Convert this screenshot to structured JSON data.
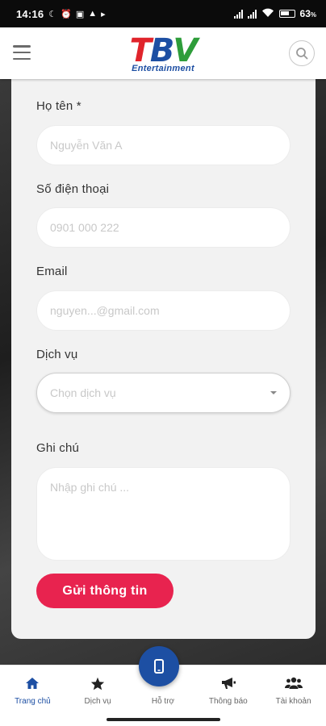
{
  "status_bar": {
    "time": "14:16",
    "battery_percent": "63"
  },
  "header": {
    "logo_letters": [
      "T",
      "B",
      "V"
    ],
    "logo_subtitle": "Entertainment"
  },
  "form": {
    "name_label": "Họ tên *",
    "name_placeholder": "Nguyễn Văn A",
    "phone_label": "Số điện thoại",
    "phone_placeholder": "0901 000 222",
    "email_label": "Email",
    "email_placeholder": "nguyen...@gmail.com",
    "service_label": "Dịch vụ",
    "service_placeholder": "Chọn dịch vụ",
    "note_label": "Ghi chú",
    "note_placeholder": "Nhập ghi chú ...",
    "submit_label": "Gửi thông tin"
  },
  "bottom_nav": {
    "items": [
      {
        "label": "Trang chủ",
        "icon": "home-icon",
        "active": true
      },
      {
        "label": "Dịch vụ",
        "icon": "star-icon",
        "active": false
      },
      {
        "label": "Hỗ trợ",
        "icon": "phone-icon",
        "active": false
      },
      {
        "label": "Thông báo",
        "icon": "megaphone-icon",
        "active": false
      },
      {
        "label": "Tài khoản",
        "icon": "users-icon",
        "active": false
      }
    ]
  },
  "colors": {
    "brand_blue": "#1d4fa3",
    "brand_red": "#e0242b",
    "brand_green": "#2e9d3a",
    "submit": "#e8234f"
  }
}
